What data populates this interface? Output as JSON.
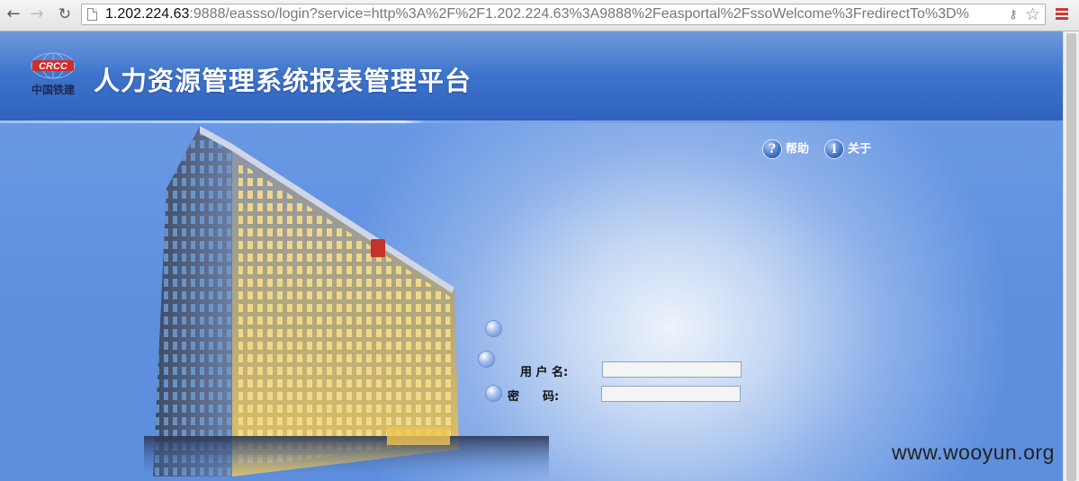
{
  "browser": {
    "url_host": "1.202.224.63",
    "url_rest": ":9888/eassso/login?service=http%3A%2F%2F1.202.224.63%3A9888%2Feasportal%2FssoWelcome%3FredirectTo%3D%"
  },
  "header": {
    "logo_text": "中国铁建",
    "logo_mark": "CRCC",
    "title": "人力资源管理系统报表管理平台"
  },
  "links": {
    "help_label": "帮助",
    "about_label": "关于"
  },
  "login": {
    "username_label": "用 户 名:",
    "password_label": "密　　码:",
    "username_value": "",
    "password_value": ""
  },
  "watermark": "www.wooyun.org",
  "colors": {
    "header_blue": "#3f75cc",
    "page_blue": "#5d8fdf",
    "title_text": "#ffffff"
  }
}
